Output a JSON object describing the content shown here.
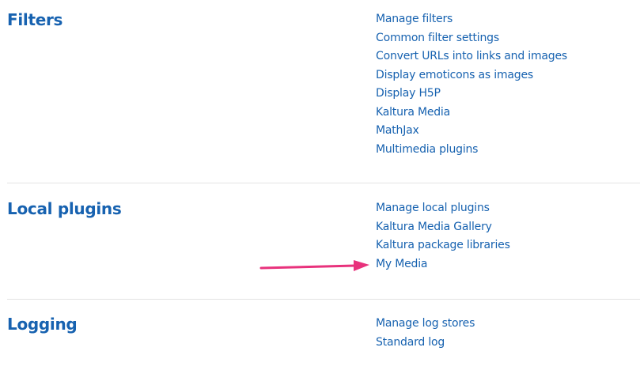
{
  "sections": [
    {
      "title": "Filters",
      "links": [
        "Manage filters",
        "Common filter settings",
        "Convert URLs into links and images",
        "Display emoticons as images",
        "Display H5P",
        "Kaltura Media",
        "MathJax",
        "Multimedia plugins"
      ]
    },
    {
      "title": "Local plugins",
      "links": [
        "Manage local plugins",
        "Kaltura Media Gallery",
        "Kaltura package libraries",
        "My Media"
      ]
    },
    {
      "title": "Logging",
      "links": [
        "Manage log stores",
        "Standard log"
      ]
    }
  ],
  "colors": {
    "link": "#1762b0",
    "divider": "#e3e3e3",
    "arrow": "#e8327c"
  },
  "annotation": {
    "arrow_target": "My Media",
    "icon": "arrow-right-icon"
  }
}
